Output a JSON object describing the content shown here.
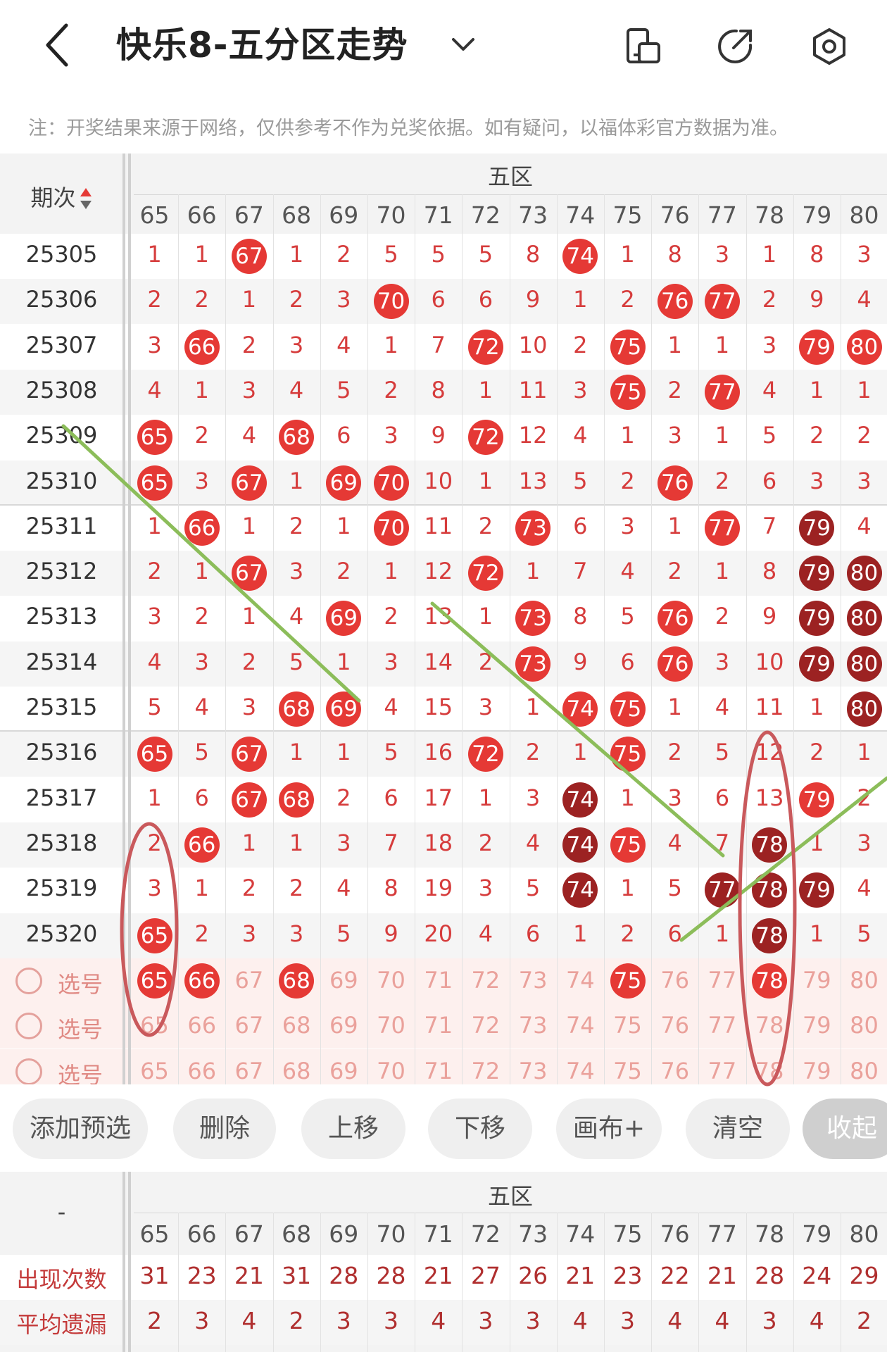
{
  "header": {
    "title": "快乐8-五分区走势",
    "back_icon": "chevron-left-icon",
    "dropdown_icon": "chevron-down-icon",
    "icons": [
      "device-rotate-icon",
      "share-icon",
      "settings-icon"
    ]
  },
  "notice": "注：开奖结果来源于网络，仅供参考不作为兑奖依据。如有疑问，以福体彩官方数据为准。",
  "table": {
    "zone_label": "五区",
    "period_label": "期次",
    "columns": [
      "65",
      "66",
      "67",
      "68",
      "69",
      "70",
      "71",
      "72",
      "73",
      "74",
      "75",
      "76",
      "77",
      "78",
      "79",
      "80"
    ],
    "rows": [
      {
        "period": "25305",
        "cells": [
          "1",
          "1",
          "67",
          "1",
          "2",
          "5",
          "5",
          "5",
          "8",
          "74",
          "1",
          "8",
          "3",
          "1",
          "8",
          "3"
        ],
        "hits": [
          2,
          9
        ],
        "dark": []
      },
      {
        "period": "25306",
        "cells": [
          "2",
          "2",
          "1",
          "2",
          "3",
          "70",
          "6",
          "6",
          "9",
          "1",
          "2",
          "76",
          "77",
          "2",
          "9",
          "4"
        ],
        "hits": [
          5,
          11,
          12
        ],
        "dark": []
      },
      {
        "period": "25307",
        "cells": [
          "3",
          "66",
          "2",
          "3",
          "4",
          "1",
          "7",
          "72",
          "10",
          "2",
          "75",
          "1",
          "1",
          "3",
          "79",
          "80"
        ],
        "hits": [
          1,
          7,
          10,
          14,
          15
        ],
        "dark": []
      },
      {
        "period": "25308",
        "cells": [
          "4",
          "1",
          "3",
          "4",
          "5",
          "2",
          "8",
          "1",
          "11",
          "3",
          "75",
          "2",
          "77",
          "4",
          "1",
          "1"
        ],
        "hits": [
          10,
          12
        ],
        "dark": []
      },
      {
        "period": "25309",
        "cells": [
          "65",
          "2",
          "4",
          "68",
          "6",
          "3",
          "9",
          "72",
          "12",
          "4",
          "1",
          "3",
          "1",
          "5",
          "2",
          "2"
        ],
        "hits": [
          0,
          3,
          7
        ],
        "dark": []
      },
      {
        "period": "25310",
        "cells": [
          "65",
          "3",
          "67",
          "1",
          "69",
          "70",
          "10",
          "1",
          "13",
          "5",
          "2",
          "76",
          "2",
          "6",
          "3",
          "3"
        ],
        "hits": [
          0,
          2,
          4,
          5,
          11
        ],
        "dark": []
      },
      {
        "period": "25311",
        "cells": [
          "1",
          "66",
          "1",
          "2",
          "1",
          "70",
          "11",
          "2",
          "73",
          "6",
          "3",
          "1",
          "77",
          "7",
          "79",
          "4"
        ],
        "hits": [
          1,
          5,
          8,
          12,
          14
        ],
        "dark": [
          14
        ]
      },
      {
        "period": "25312",
        "cells": [
          "2",
          "1",
          "67",
          "3",
          "2",
          "1",
          "12",
          "72",
          "1",
          "7",
          "4",
          "2",
          "1",
          "8",
          "79",
          "80"
        ],
        "hits": [
          2,
          7,
          14,
          15
        ],
        "dark": [
          14,
          15
        ]
      },
      {
        "period": "25313",
        "cells": [
          "3",
          "2",
          "1",
          "4",
          "69",
          "2",
          "13",
          "1",
          "73",
          "8",
          "5",
          "76",
          "2",
          "9",
          "79",
          "80"
        ],
        "hits": [
          4,
          8,
          11,
          14,
          15
        ],
        "dark": [
          14,
          15
        ]
      },
      {
        "period": "25314",
        "cells": [
          "4",
          "3",
          "2",
          "5",
          "1",
          "3",
          "14",
          "2",
          "73",
          "9",
          "6",
          "76",
          "3",
          "10",
          "79",
          "80"
        ],
        "hits": [
          8,
          11,
          14,
          15
        ],
        "dark": [
          14,
          15
        ]
      },
      {
        "period": "25315",
        "cells": [
          "5",
          "4",
          "3",
          "68",
          "69",
          "4",
          "15",
          "3",
          "1",
          "74",
          "75",
          "1",
          "4",
          "11",
          "1",
          "80"
        ],
        "hits": [
          3,
          4,
          9,
          10,
          15
        ],
        "dark": [
          15
        ]
      },
      {
        "period": "25316",
        "cells": [
          "65",
          "5",
          "67",
          "1",
          "1",
          "5",
          "16",
          "72",
          "2",
          "1",
          "75",
          "2",
          "5",
          "12",
          "2",
          "1"
        ],
        "hits": [
          0,
          2,
          7,
          10
        ],
        "dark": []
      },
      {
        "period": "25317",
        "cells": [
          "1",
          "6",
          "67",
          "68",
          "2",
          "6",
          "17",
          "1",
          "3",
          "74",
          "1",
          "3",
          "6",
          "13",
          "79",
          "2"
        ],
        "hits": [
          2,
          3,
          9,
          14
        ],
        "dark": [
          9
        ]
      },
      {
        "period": "25318",
        "cells": [
          "2",
          "66",
          "1",
          "1",
          "3",
          "7",
          "18",
          "2",
          "4",
          "74",
          "75",
          "4",
          "7",
          "78",
          "1",
          "3"
        ],
        "hits": [
          1,
          9,
          10,
          13
        ],
        "dark": [
          9,
          13
        ]
      },
      {
        "period": "25319",
        "cells": [
          "3",
          "1",
          "2",
          "2",
          "4",
          "8",
          "19",
          "3",
          "5",
          "74",
          "1",
          "5",
          "77",
          "78",
          "79",
          "4"
        ],
        "hits": [
          9,
          12,
          13,
          14
        ],
        "dark": [
          9,
          12,
          13,
          14
        ]
      },
      {
        "period": "25320",
        "cells": [
          "65",
          "2",
          "3",
          "3",
          "5",
          "9",
          "20",
          "4",
          "6",
          "1",
          "2",
          "6",
          "1",
          "78",
          "1",
          "5"
        ],
        "hits": [
          0,
          13
        ],
        "dark": [
          13
        ]
      }
    ],
    "select_rows": [
      {
        "label": "选号",
        "picked": [
          0,
          1,
          3,
          10,
          13
        ]
      },
      {
        "label": "选号",
        "picked": []
      },
      {
        "label": "选号",
        "picked": []
      }
    ]
  },
  "buttons": [
    "添加预选",
    "删除",
    "上移",
    "下移",
    "画布+",
    "清空",
    "收起"
  ],
  "stats": {
    "zone_label": "五区",
    "corner": "-",
    "rows": [
      {
        "label": "出现次数",
        "values": [
          "31",
          "23",
          "21",
          "31",
          "28",
          "28",
          "21",
          "27",
          "26",
          "21",
          "23",
          "22",
          "21",
          "28",
          "24",
          "29"
        ]
      },
      {
        "label": "平均遗漏",
        "values": [
          "2",
          "3",
          "4",
          "2",
          "3",
          "3",
          "4",
          "3",
          "3",
          "4",
          "3",
          "4",
          "4",
          "3",
          "4",
          "2"
        ]
      }
    ]
  },
  "colors": {
    "accent": "#e53935",
    "dark_ball": "#9c2222",
    "annotation_green": "#8cbd5a",
    "annotation_red": "#c9595c"
  }
}
